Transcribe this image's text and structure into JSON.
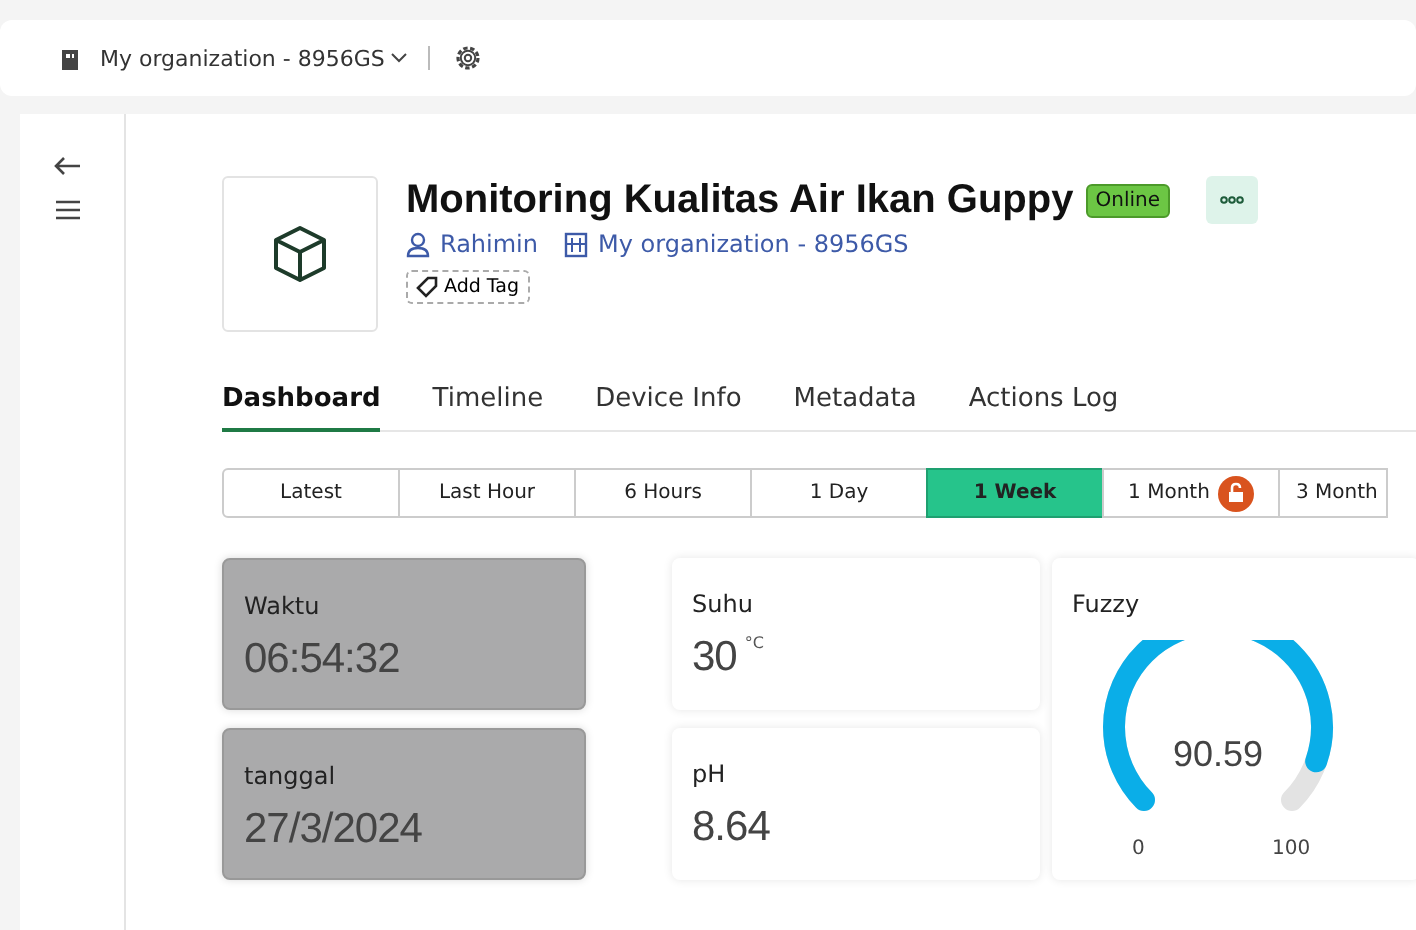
{
  "topbar": {
    "organization": "My organization - 8956GS"
  },
  "device": {
    "title": "Monitoring Kualitas Air Ikan Guppy",
    "status": "Online",
    "online": true,
    "owner": "Rahimin",
    "organization": "My organization - 8956GS",
    "add_tag": "Add Tag"
  },
  "tabs": [
    {
      "label": "Dashboard",
      "selected": true
    },
    {
      "label": "Timeline",
      "selected": false
    },
    {
      "label": "Device Info",
      "selected": false
    },
    {
      "label": "Metadata",
      "selected": false
    },
    {
      "label": "Actions Log",
      "selected": false
    }
  ],
  "ranges": [
    {
      "label": "Latest",
      "selected": false,
      "locked": false
    },
    {
      "label": "Last Hour",
      "selected": false,
      "locked": false
    },
    {
      "label": "6 Hours",
      "selected": false,
      "locked": false
    },
    {
      "label": "1 Day",
      "selected": false,
      "locked": false
    },
    {
      "label": "1 Week",
      "selected": true,
      "locked": false
    },
    {
      "label": "1 Month",
      "selected": false,
      "locked": true
    },
    {
      "label": "3 Month",
      "selected": false,
      "locked": false
    }
  ],
  "widgets": [
    {
      "kind": "value",
      "label": "Waktu",
      "value": "06:54:32",
      "disabled": true
    },
    {
      "kind": "value",
      "label": "tanggal",
      "value": "27/3/2024",
      "disabled": true
    },
    {
      "kind": "value",
      "label": "Suhu",
      "value": "30",
      "unit": "°C",
      "disabled": false
    },
    {
      "kind": "value",
      "label": "pH",
      "value": "8.64",
      "disabled": false
    },
    {
      "kind": "gauge",
      "label": "Fuzzy",
      "value": "90.59",
      "min": "0",
      "max": "100"
    }
  ]
}
